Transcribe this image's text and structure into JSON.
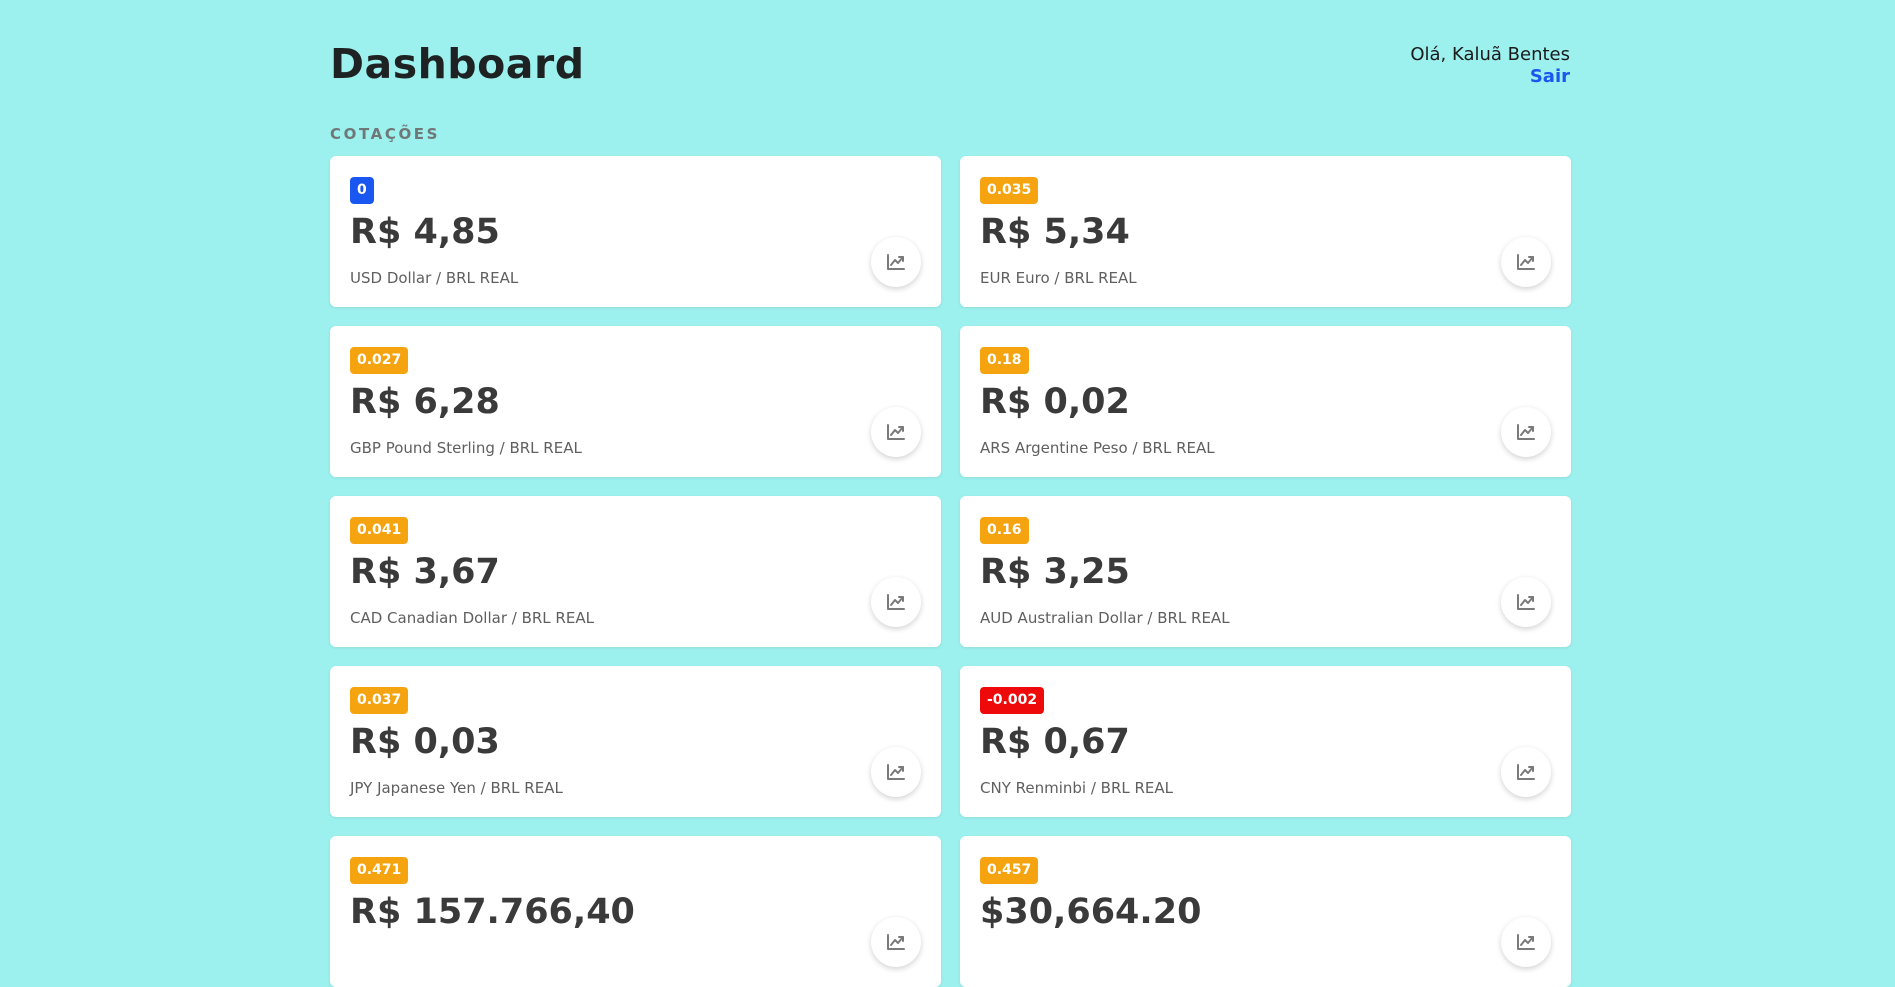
{
  "header": {
    "title": "Dashboard",
    "greeting": "Olá, Kaluã Bentes",
    "logout_label": "Sair"
  },
  "section_label": "COTAÇÕES",
  "colors": {
    "background": "#9cf0ee",
    "badge_neutral": "#1a56f0",
    "badge_positive": "#f5a410",
    "badge_negative": "#ee0a0a",
    "link": "#1a56f0"
  },
  "cards": [
    {
      "badge": "0",
      "badge_status": "neutral",
      "price": "R$ 4,85",
      "pair": "USD Dollar / BRL REAL",
      "icon": "chart-line-icon"
    },
    {
      "badge": "0.035",
      "badge_status": "positive",
      "price": "R$ 5,34",
      "pair": "EUR Euro / BRL REAL",
      "icon": "chart-line-icon"
    },
    {
      "badge": "0.027",
      "badge_status": "positive",
      "price": "R$ 6,28",
      "pair": "GBP Pound Sterling / BRL REAL",
      "icon": "chart-line-icon"
    },
    {
      "badge": "0.18",
      "badge_status": "positive",
      "price": "R$ 0,02",
      "pair": "ARS Argentine Peso / BRL REAL",
      "icon": "chart-line-icon"
    },
    {
      "badge": "0.041",
      "badge_status": "positive",
      "price": "R$ 3,67",
      "pair": "CAD Canadian Dollar / BRL REAL",
      "icon": "chart-line-icon"
    },
    {
      "badge": "0.16",
      "badge_status": "positive",
      "price": "R$ 3,25",
      "pair": "AUD Australian Dollar / BRL REAL",
      "icon": "chart-line-icon"
    },
    {
      "badge": "0.037",
      "badge_status": "positive",
      "price": "R$ 0,03",
      "pair": "JPY Japanese Yen / BRL REAL",
      "icon": "chart-line-icon"
    },
    {
      "badge": "-0.002",
      "badge_status": "negative",
      "price": "R$ 0,67",
      "pair": "CNY Renminbi / BRL REAL",
      "icon": "chart-line-icon"
    },
    {
      "badge": "0.471",
      "badge_status": "positive",
      "price": "R$ 157.766,40",
      "pair": "",
      "icon": "chart-line-icon"
    },
    {
      "badge": "0.457",
      "badge_status": "positive",
      "price": "$30,664.20",
      "pair": "",
      "icon": "chart-line-icon"
    }
  ]
}
